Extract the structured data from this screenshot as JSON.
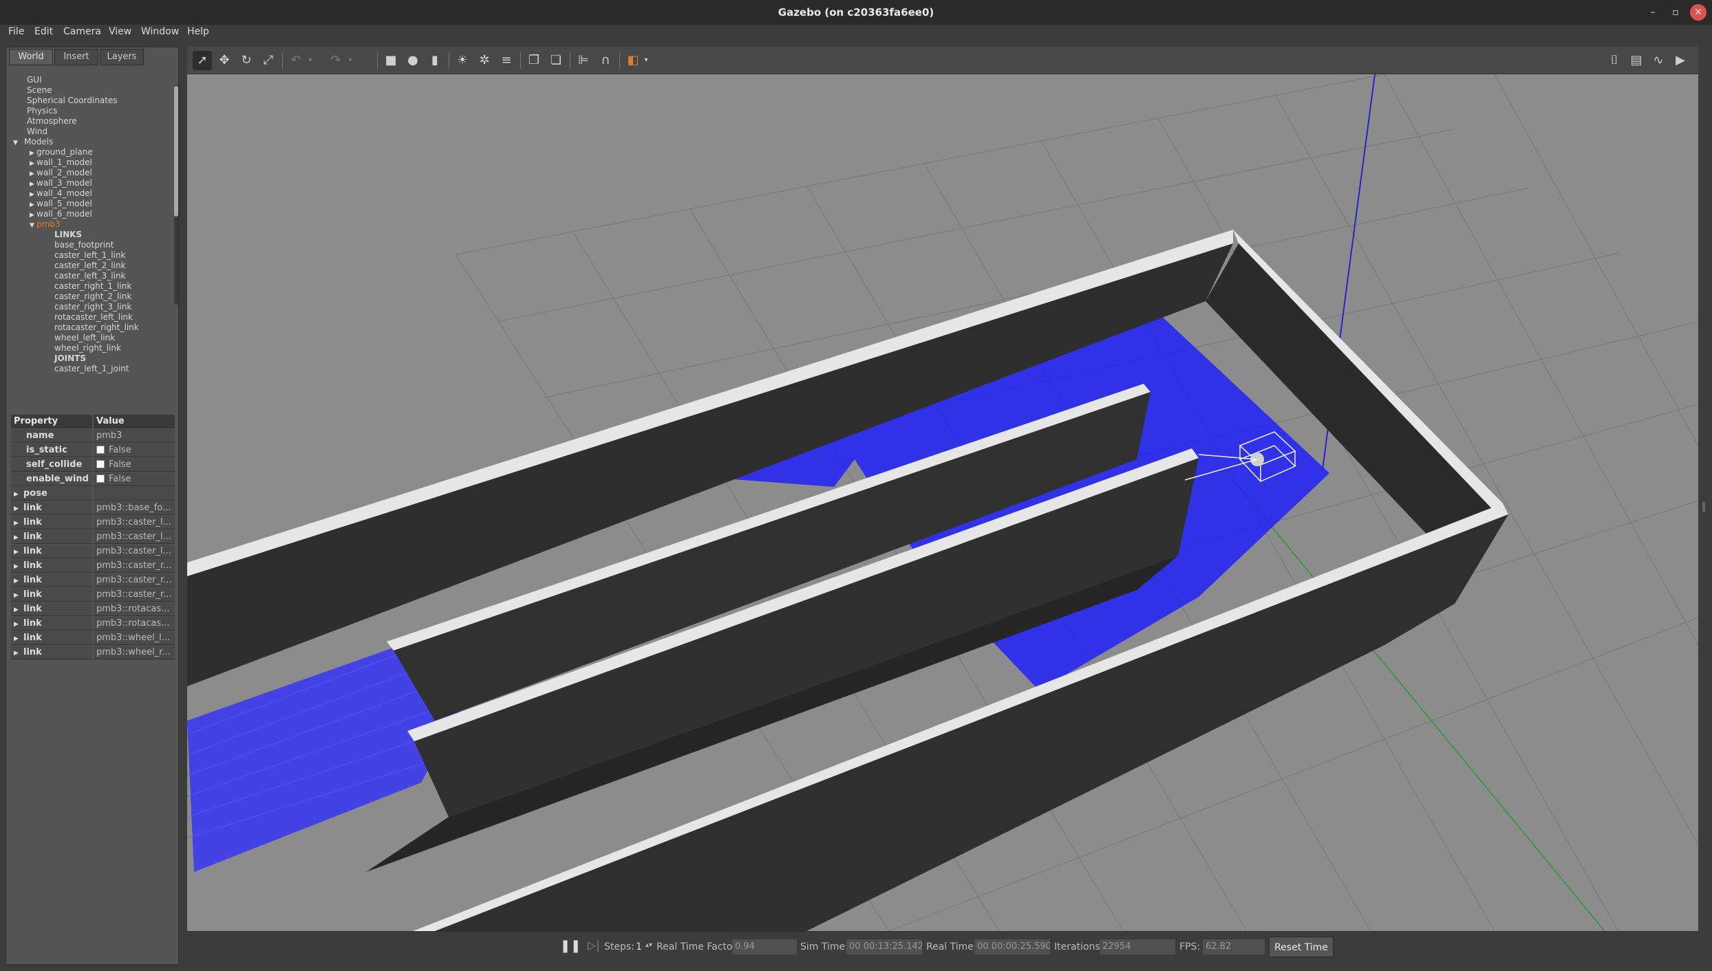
{
  "window": {
    "title": "Gazebo (on c20363fa6ee0)"
  },
  "menu": [
    "File",
    "Edit",
    "Camera",
    "View",
    "Window",
    "Help"
  ],
  "left_tabs": [
    "World",
    "Insert",
    "Layers"
  ],
  "tree": {
    "items": [
      "GUI",
      "Scene",
      "Spherical Coordinates",
      "Physics",
      "Atmosphere",
      "Wind"
    ],
    "models_label": "Models",
    "models": [
      "ground_plane",
      "wall_1_model",
      "wall_2_model",
      "wall_3_model",
      "wall_4_model",
      "wall_5_model",
      "wall_6_model"
    ],
    "selected_model": "pmb3",
    "links_header": "LINKS",
    "links": [
      "base_footprint",
      "caster_left_1_link",
      "caster_left_2_link",
      "caster_left_3_link",
      "caster_right_1_link",
      "caster_right_2_link",
      "caster_right_3_link",
      "rotacaster_left_link",
      "rotacaster_right_link",
      "wheel_left_link",
      "wheel_right_link"
    ],
    "joints_header": "JOINTS",
    "joints": [
      "caster_left_1_joint"
    ]
  },
  "properties": {
    "header": {
      "key": "Property",
      "value": "Value"
    },
    "rows": [
      {
        "key": "name",
        "value": "pmb3"
      },
      {
        "key": "is_static",
        "value": "False"
      },
      {
        "key": "self_collide",
        "value": "False"
      },
      {
        "key": "enable_wind",
        "value": "False"
      },
      {
        "key": "pose",
        "value": ""
      },
      {
        "key": "link",
        "value": "pmb3::base_fo..."
      },
      {
        "key": "link",
        "value": "pmb3::caster_l..."
      },
      {
        "key": "link",
        "value": "pmb3::caster_l..."
      },
      {
        "key": "link",
        "value": "pmb3::caster_l..."
      },
      {
        "key": "link",
        "value": "pmb3::caster_r..."
      },
      {
        "key": "link",
        "value": "pmb3::caster_r..."
      },
      {
        "key": "link",
        "value": "pmb3::caster_r..."
      },
      {
        "key": "link",
        "value": "pmb3::rotacas..."
      },
      {
        "key": "link",
        "value": "pmb3::rotacas..."
      },
      {
        "key": "link",
        "value": "pmb3::wheel_l..."
      },
      {
        "key": "link",
        "value": "pmb3::wheel_r..."
      }
    ]
  },
  "status": {
    "steps_label": "Steps:",
    "steps_value": "1",
    "rtf_label": "Real Time Factor:",
    "rtf_value": "0.94",
    "sim_time_label": "Sim Time:",
    "sim_time_value": "00 00:13:25.142",
    "real_time_label": "Real Time:",
    "real_time_value": "00 00:00:25.590",
    "iterations_label": "Iterations:",
    "iterations_value": "22954",
    "fps_label": "FPS:",
    "fps_value": "62.82",
    "reset_label": "Reset Time"
  },
  "colors": {
    "laser": "#1a1aff",
    "wall_top": "#e6e6e6",
    "wall_side": "#2e2e2e",
    "ground": "#8c8c8c",
    "selected": "#e07b2a"
  }
}
